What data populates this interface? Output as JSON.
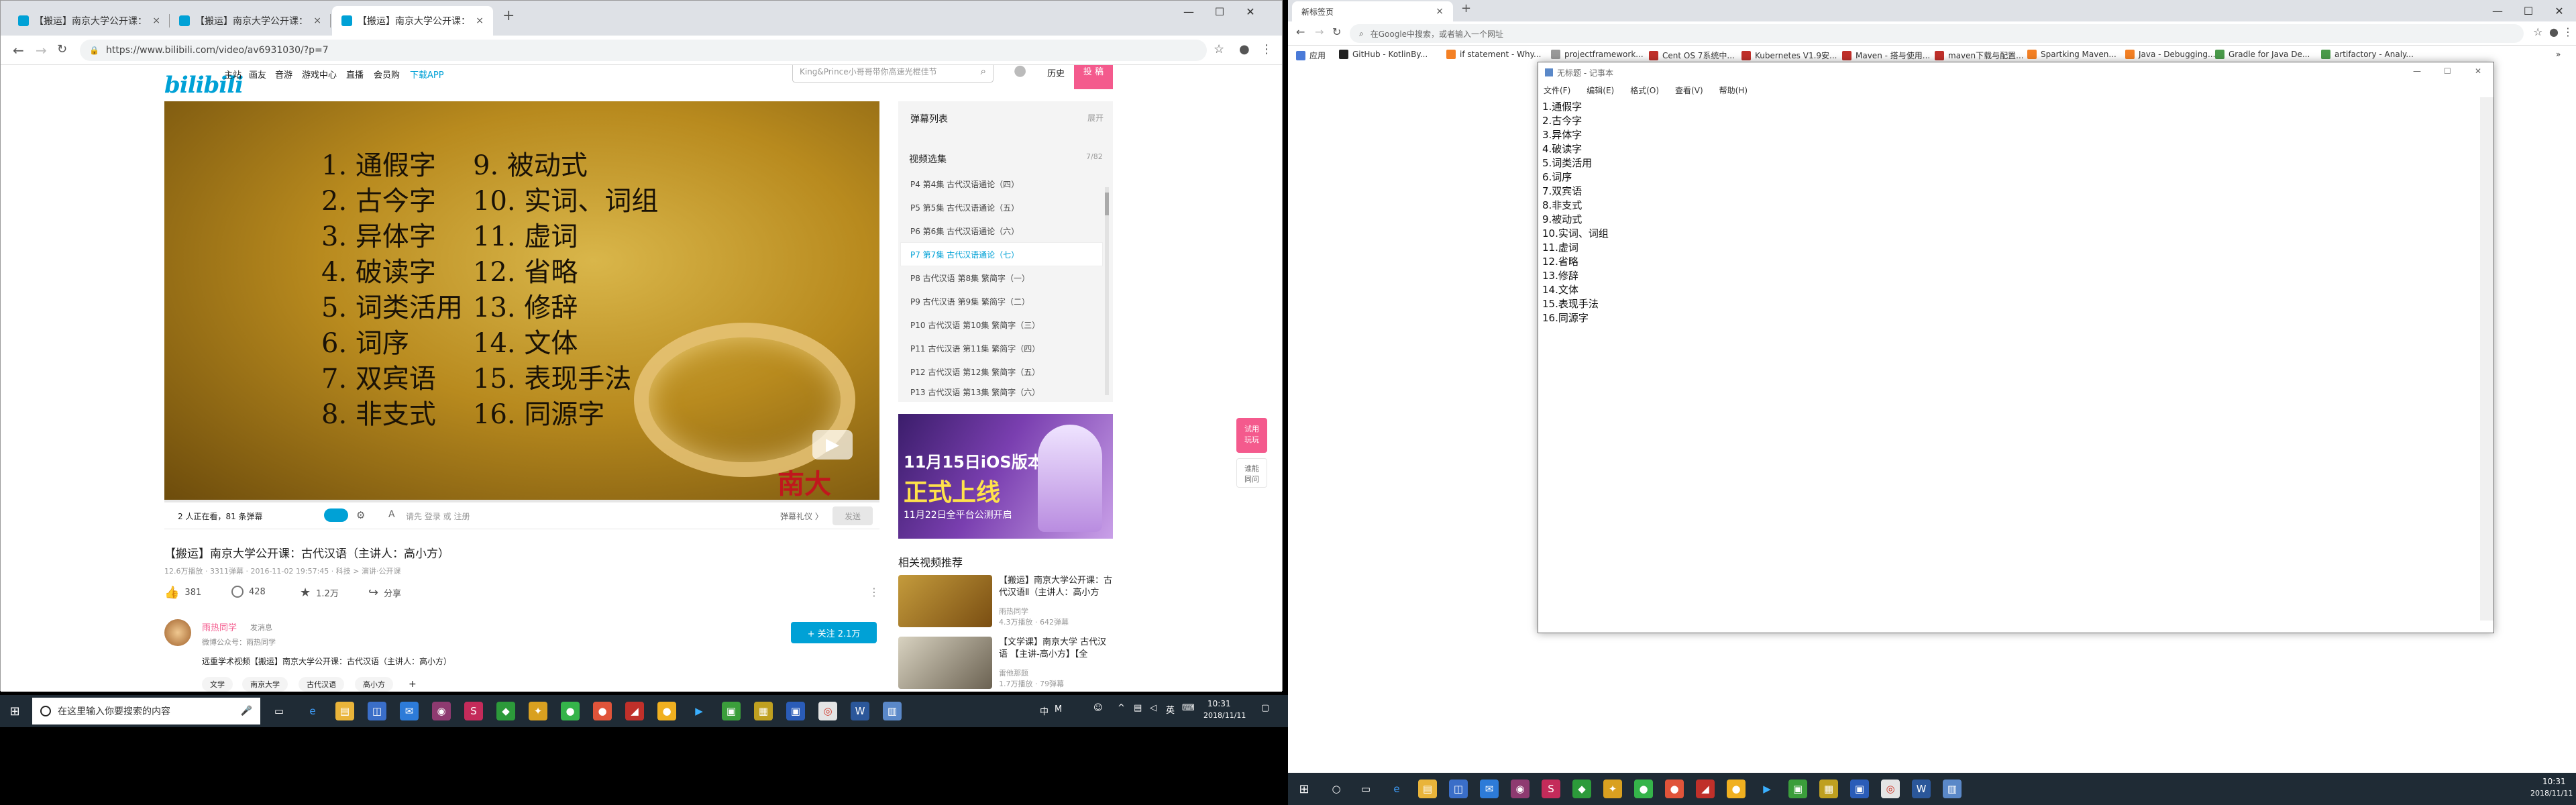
{
  "left_browser": {
    "tabs": [
      {
        "title": "【搬运】南京大学公开课：古代汉",
        "close": "×"
      },
      {
        "title": "【搬运】南京大学公开课：古代汉",
        "close": "×"
      },
      {
        "title": "【搬运】南京大学公开课：古代汉",
        "close": "×"
      }
    ],
    "new_tab": "+",
    "url": "https://www.bilibili.com/video/av6931030/?p=7",
    "window_controls": {
      "minimize": "—",
      "maximize": "☐",
      "close": "✕"
    }
  },
  "bilibili": {
    "logo": "bilibili",
    "nav": [
      "主站",
      "画友",
      "音游",
      "游戏中心",
      "直播",
      "会员购",
      "下载APP"
    ],
    "search_placeholder": "King&Prince小哥哥带你高速光棍佳节",
    "history": "历史",
    "submit": "投 稿",
    "video_text": [
      "1. 通假字",
      "2. 古今字",
      "3. 异体字",
      "4. 破读字",
      "5. 词类活用",
      "6. 词序",
      "7. 双宾语",
      "8. 非支式",
      "9. 被动式",
      "10. 实词、词组",
      "11. 虚词",
      "12. 省略",
      "13. 修辞",
      "14. 文体",
      "15. 表现手法",
      "16. 同源字"
    ],
    "video_watermark": "南大",
    "danmu_status": "2 人正在看，81 条弹幕",
    "danmu_hint": "请先 登录 或 注册",
    "danmu_rule": "弹幕礼仪 〉",
    "danmu_send": "发送",
    "side": {
      "danmu_list": "弹幕列表",
      "expand": "展开",
      "playlist_title": "视频选集",
      "playlist_count": "7/82",
      "episodes": [
        "P4  第4集 古代汉语通论（四）",
        "P5  第5集 古代汉语通论（五）",
        "P6  第6集 古代汉语通论（六）",
        "P7  第7集 古代汉语通论（七）",
        "P8  古代汉语 第8集 繁简字（一）",
        "P9  古代汉语 第9集 繁简字（二）",
        "P10  古代汉语 第10集 繁简字（三）",
        "P11  古代汉语 第11集 繁简字（四）",
        "P12  古代汉语 第12集 繁简字（五）",
        "P13  古代汉语 第13集 繁简字（六）"
      ]
    },
    "banner": {
      "line1": "11月15日iOS版本",
      "line2": "正式上线",
      "line3": "11月22日全平台公测开启"
    },
    "related_title": "相关视频推荐",
    "related": [
      {
        "title": "【搬运】南京大学公开课：古代汉语Ⅱ（主讲人：高小方",
        "author": "雨热同学",
        "stats": "4.3万播放 · 642弹幕"
      },
      {
        "title": "【文学课】南京大学 古代汉语 【主讲-高小方】【全",
        "author": "雷他那题",
        "stats": "1.7万播放 · 79弹幕"
      }
    ],
    "video_title": "【搬运】南京大学公开课：古代汉语（主讲人：高小方）",
    "video_meta": "12.6万播放 · 3311弹幕 · 2016-11-02 19:57:45 · 科技 > 演讲·公开课",
    "likes": "381",
    "coins": "428",
    "favorites": "1.2万",
    "share": "分享",
    "uploader": "雨热同学",
    "message": "发消息",
    "uploader_desc": "微博公众号：雨热同学",
    "follow": "+ 关注 2.1万",
    "description": "远重学术视频【搬运】南京大学公开课：古代汉语（主讲人：高小方）",
    "tags": [
      "文学",
      "南京大学",
      "古代汉语",
      "高小方",
      "+"
    ],
    "float_game": "试用\n玩玩",
    "float_report": "谁能\n同问"
  },
  "taskbar_left": {
    "search_placeholder": "在这里输入你要搜索的内容",
    "tray_ime": "中",
    "tray_m": "M",
    "time": "10:31",
    "date": "2018/11/11"
  },
  "right_browser": {
    "tab": "新标签页",
    "new_tab": "+",
    "omnibox": "在Google中搜索，或者输入一个网址",
    "bookmarks": [
      "应用",
      "GitHub - KotlinBy...",
      "if statement - Why...",
      "projectframework...",
      "Cent OS 7系统中...",
      "Kubernetes V1.9安...",
      "Maven - 搭与使用...",
      "maven下载与配置...",
      "Spartking Maven...",
      "Java - Debugging...",
      "Gradle for Java De...",
      "artifactory - Analy..."
    ]
  },
  "notepad": {
    "title": "无标题 - 记事本",
    "menus": [
      "文件(F)",
      "编辑(E)",
      "格式(O)",
      "查看(V)",
      "帮助(H)"
    ],
    "lines": [
      "1.通假字",
      "2.古今字",
      "3.异体字",
      "4.破读字",
      "5.词类活用",
      "6.词序",
      "7.双宾语",
      "8.非支式",
      "9.被动式",
      "10.实词、词组",
      "11.虚词",
      "12.省略",
      "13.修辞",
      "14.文体",
      "15.表现手法",
      "16.同源字"
    ]
  },
  "taskbar_right": {
    "time": "10:31",
    "date": "2018/11/11"
  }
}
